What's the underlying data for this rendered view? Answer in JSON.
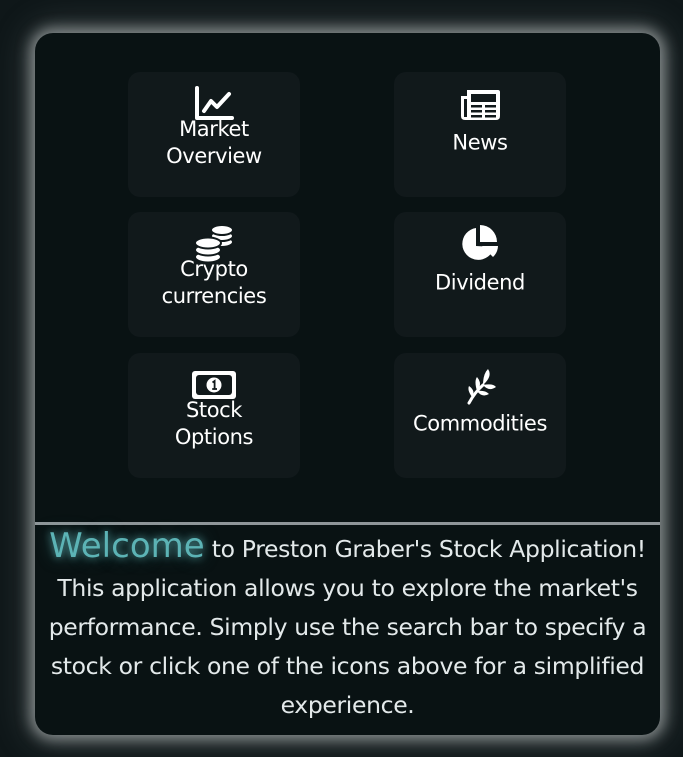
{
  "tiles": [
    {
      "label": "Market\nOverview",
      "icon": "line-chart-icon"
    },
    {
      "label": "News",
      "icon": "newspaper-icon"
    },
    {
      "label": "Crypto\ncurrencies",
      "icon": "coins-icon"
    },
    {
      "label": "Dividend",
      "icon": "pie-chart-icon"
    },
    {
      "label": "Stock\nOptions",
      "icon": "money-bill-icon"
    },
    {
      "label": "Commodities",
      "icon": "seedling-icon"
    }
  ],
  "welcome": {
    "highlight": "Welcome",
    "text": " to Preston Graber's Stock Application! This application allows you to explore the market's performance. Simply use the search bar to specify a stock or click one of the icons above for a simplified experience."
  },
  "colors": {
    "page_bg": "#0f1719",
    "panel_bg": "#091213",
    "tile_bg": "#11191b",
    "accent": "#5cb3b5",
    "text": "#e3e9ea"
  }
}
